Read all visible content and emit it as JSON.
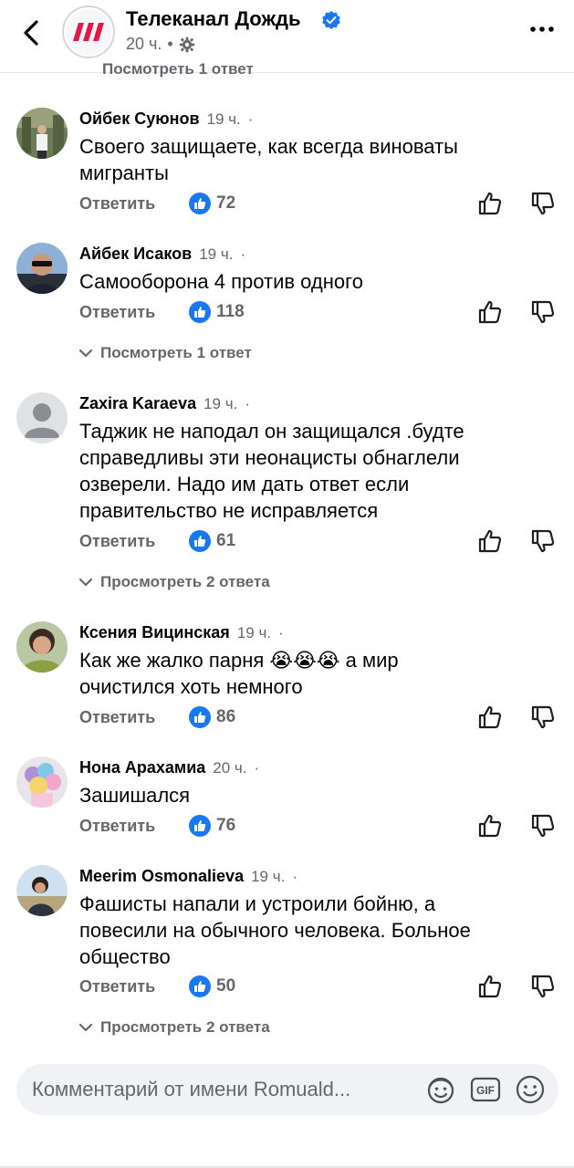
{
  "header": {
    "channel_name": "Телеканал Дождь",
    "post_time": "20 ч.",
    "meta_separator": "•",
    "peek_text": "Посмотреть 1 ответ"
  },
  "colors": {
    "accent": "#1877f2",
    "logo_red": "#e3174a",
    "muted": "#65676b"
  },
  "icons": [
    "back-chevron-icon",
    "verified-icon",
    "privacy-gear-icon",
    "more-icon",
    "like-icon",
    "thumb-up-icon",
    "thumb-down-icon",
    "chevron-down-icon",
    "avatar-sticker-icon",
    "gif-icon",
    "emoji-icon"
  ],
  "comments": [
    {
      "author": "Ойбек Суюнов",
      "time": "19 ч.",
      "text_lines": [
        "Своего защищаете, как всегда виноваты",
        "мигранты"
      ],
      "reply_label": "Ответить",
      "likes": "72",
      "replies": ""
    },
    {
      "author": "Айбек Исаков",
      "time": "19 ч.",
      "text_lines": [
        "Самооборона  4 против одного"
      ],
      "reply_label": "Ответить",
      "likes": "118",
      "replies": "Посмотреть 1 ответ"
    },
    {
      "author": "Zaxira Karaeva",
      "time": "19 ч.",
      "text_lines": [
        "Таджик не наподал он защищался .будте",
        "справедливы эти неонацисты обнаглели",
        "озверели. Надо им дать ответ если",
        "правительство не исправляется"
      ],
      "reply_label": "Ответить",
      "likes": "61",
      "replies": "Просмотреть 2 ответа"
    },
    {
      "author": "Ксения Вицинская",
      "time": "19 ч.",
      "text_lines": [
        "Как же жалко парня 😭😭😭 а мир",
        "очистился хоть немного"
      ],
      "reply_label": "Ответить",
      "likes": "86",
      "replies": ""
    },
    {
      "author": "Нона Арахамиа",
      "time": "20 ч.",
      "text_lines": [
        "Зашишался"
      ],
      "reply_label": "Ответить",
      "likes": "76",
      "replies": ""
    },
    {
      "author": "Meerim Osmonalieva",
      "time": "19 ч.",
      "text_lines": [
        "Фашисты напали и устроили бойню, а",
        "повесили на обычного человека. Больное",
        "общество"
      ],
      "reply_label": "Ответить",
      "likes": "50",
      "replies": "Просмотреть 2 ответа"
    }
  ],
  "composer": {
    "placeholder": "Комментарий от имени Romuald..."
  }
}
